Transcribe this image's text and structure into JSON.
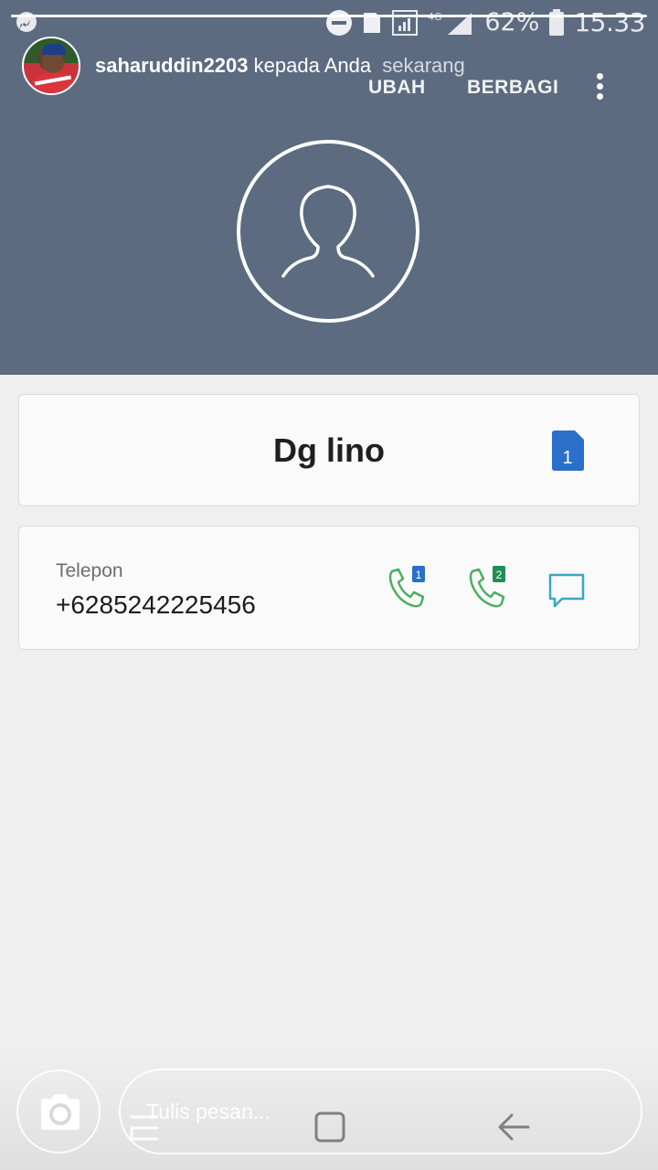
{
  "status_bar": {
    "battery_percent": "62%",
    "time": "15.33",
    "network": "4G",
    "sim_indicator": "1",
    "icons": [
      "messenger-icon",
      "do-not-disturb-icon",
      "sim-icon",
      "signal-icon",
      "battery-icon"
    ]
  },
  "story": {
    "username": "saharuddin2203",
    "recipient_text": "kepada Anda",
    "time_ago": "sekarang",
    "progress": 1.0
  },
  "actions": {
    "edit_label": "UBAH",
    "share_label": "BERBAGI"
  },
  "contact": {
    "name": "Dg lino",
    "sim_badge": "1",
    "phone_label": "Telepon",
    "phone_number": "+6285242225456",
    "call_sim1_badge": "1",
    "call_sim2_badge": "2"
  },
  "composer": {
    "placeholder": "Tulis pesan..."
  },
  "colors": {
    "header_bg": "#5c6b80",
    "page_bg": "#efefef",
    "card_bg": "#fafafa",
    "sim1_blue": "#2a6fc9",
    "sim2_green": "#1e8f55",
    "call_green": "#4cae62",
    "message_cyan": "#39a7c7"
  }
}
